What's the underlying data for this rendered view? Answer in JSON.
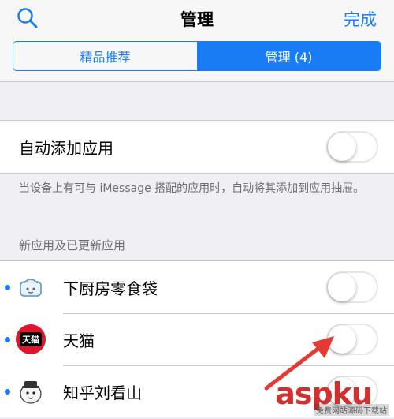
{
  "nav": {
    "title": "管理",
    "done_label": "完成",
    "search_icon": "search-icon"
  },
  "segments": [
    {
      "label": "精品推荐",
      "selected": false
    },
    {
      "label": "管理 (4)",
      "selected": true
    }
  ],
  "auto_add": {
    "label": "自动添加应用",
    "enabled": false,
    "footnote": "当设备上有可与 iMessage 搭配的应用时，自动将其添加到应用抽屉。"
  },
  "apps_section": {
    "header": "新应用及已更新应用",
    "items": [
      {
        "name": "下厨房零食袋",
        "icon": "xiachufang-icon",
        "new": true,
        "enabled": false
      },
      {
        "name": "天猫",
        "icon": "tmall-icon",
        "icon_text": "天猫",
        "new": true,
        "enabled": false
      },
      {
        "name": "知乎刘看山",
        "icon": "zhihu-liukanshan-icon",
        "new": true,
        "enabled": false
      }
    ]
  },
  "watermark": {
    "brand": "aspku",
    "sub": "免费网站源码下载站"
  },
  "colors": {
    "accent": "#1a7cf5",
    "background": "#efeff4",
    "arrow": "#e53935"
  }
}
